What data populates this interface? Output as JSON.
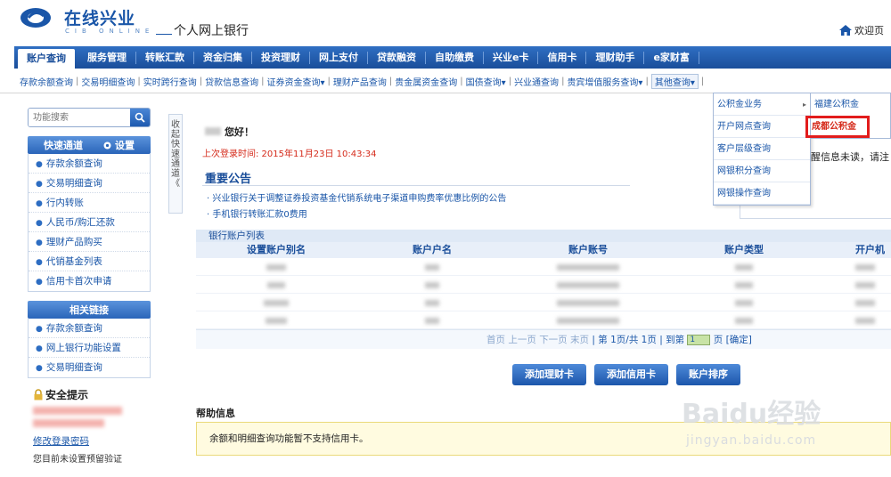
{
  "header": {
    "logo_cn": "在线兴业",
    "logo_sub": "CIB ONLINE",
    "bank_name": "个人网上银行",
    "welcome": "欢迎页"
  },
  "nav": [
    "账户查询",
    "服务管理",
    "转账汇款",
    "资金归集",
    "投资理财",
    "网上支付",
    "贷款融资",
    "自助缴费",
    "兴业e卡",
    "信用卡",
    "理财助手",
    "e家财富"
  ],
  "subnav": [
    "存款余额查询",
    "交易明细查询",
    "实时跨行查询",
    "贷款信息查询",
    "证券资金查询▾",
    "理财产品查询",
    "贵金属资金查询",
    "国债查询▾",
    "兴业通查询",
    "贵宾增值服务查询▾",
    "其他查询▾"
  ],
  "dropdown": {
    "items": [
      "公积金业务",
      "开户网点查询",
      "客户层级查询",
      "网银积分查询",
      "网银操作查询"
    ],
    "submenu": [
      "福建公积金",
      "成都公积金"
    ]
  },
  "sidebar": {
    "search_placeholder": "功能搜索",
    "quick_title": "快速通道",
    "settings": "设置",
    "quick_items": [
      "存款余额查询",
      "交易明细查询",
      "行内转账",
      "人民币/购汇还款",
      "理财产品购买",
      "代销基金列表",
      "信用卡首次申请"
    ],
    "links_title": "相关链接",
    "link_items": [
      "存款余额查询",
      "网上银行功能设置",
      "交易明细查询"
    ],
    "security_title": "安全提示",
    "change_pwd": "修改登录密码",
    "note": "您目前未设置预留验证"
  },
  "collapse_label": "收起快速通道《",
  "main": {
    "greeting": "您好！",
    "last_login": "上次登录时间: 2015年11月23日 10:43:34",
    "notice_title": "重要公告",
    "notices": [
      "兴业银行关于调整证券投资基金代销系统电子渠道申购费率优惠比例的公告",
      "手机银行转账汇款0费用"
    ],
    "reminder": "醒信息未读，请注"
  },
  "account_list": {
    "title": "银行账户列表",
    "columns": [
      "设置账户别名",
      "账户户名",
      "账户账号",
      "账户类型",
      "开户机"
    ],
    "row_count": 4,
    "pager": {
      "first": "首页",
      "prev": "上一页",
      "next": "下一页",
      "last": "末页",
      "page_info": "第 1页/共 1页",
      "goto": "到第",
      "page_value": "1",
      "page_unit": "页",
      "confirm": "[确定]"
    }
  },
  "buttons": [
    "添加理财卡",
    "添加信用卡",
    "账户排序"
  ],
  "help": {
    "title": "帮助信息",
    "text": "余额和明细查询功能暂不支持信用卡。"
  },
  "watermark": {
    "main": "Baidu经验",
    "sub": "jingyan.baidu.com"
  },
  "colors": {
    "brand": "#1a56a8",
    "nav": "#2f6fc3",
    "alert": "#d52a1a"
  }
}
